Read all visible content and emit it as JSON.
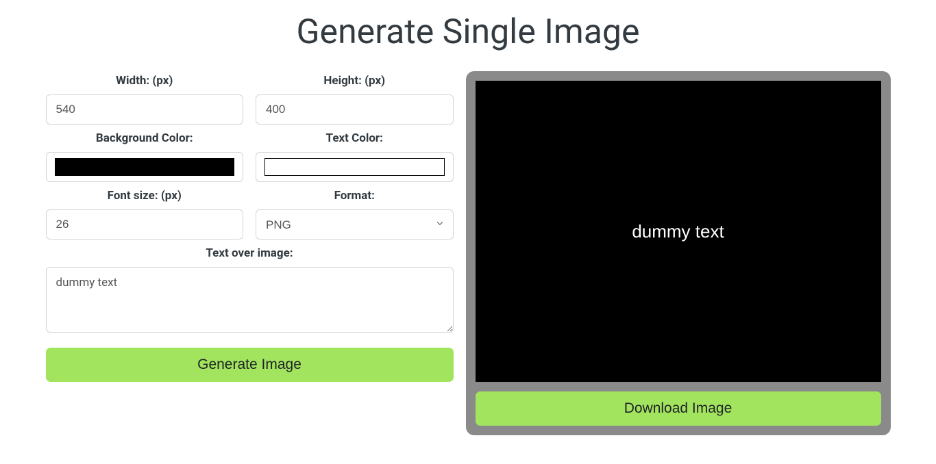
{
  "title": "Generate Single Image",
  "form": {
    "width": {
      "label": "Width: (px)",
      "value": "540"
    },
    "height": {
      "label": "Height: (px)",
      "value": "400"
    },
    "bgcolor": {
      "label": "Background Color:",
      "value": "#000000"
    },
    "textcolor": {
      "label": "Text Color:",
      "value": "#ffffff"
    },
    "fontsize": {
      "label": "Font size: (px)",
      "value": "26"
    },
    "format": {
      "label": "Format:",
      "value": "PNG"
    },
    "overlay": {
      "label": "Text over image:",
      "value": "dummy text"
    },
    "generate_label": "Generate Image"
  },
  "preview": {
    "text": "dummy text",
    "bg": "#000000",
    "fg": "#ffffff",
    "download_label": "Download Image"
  }
}
